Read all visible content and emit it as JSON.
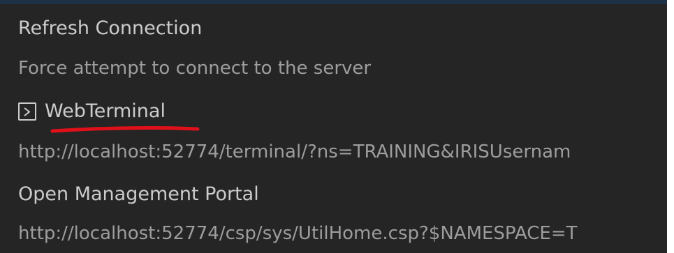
{
  "menu": {
    "items": [
      {
        "title": "Refresh Connection",
        "description": "Force attempt to connect to the server"
      },
      {
        "icon": "terminal-icon",
        "title": "WebTerminal",
        "description": "http://localhost:52774/terminal/?ns=TRAINING&IRISUsernam"
      },
      {
        "title": "Open Management Portal",
        "description": "http://localhost:52774/csp/sys/UtilHome.csp?$NAMESPACE=T"
      }
    ]
  },
  "colors": {
    "background": "#252526",
    "top_border": "#1f3146",
    "title_text": "#cccccc",
    "description_text": "#9d9d9d",
    "highlight_underline": "#e0101a"
  }
}
